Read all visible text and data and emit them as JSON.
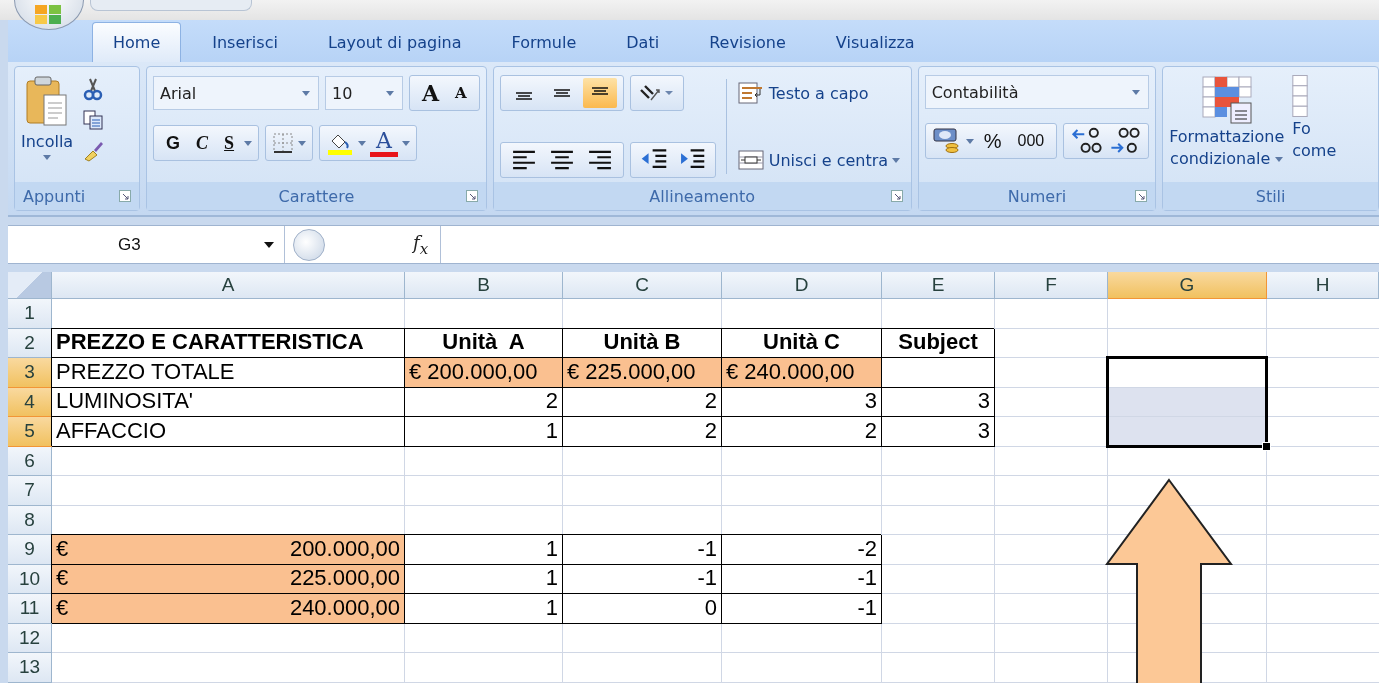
{
  "tabs": [
    {
      "label": "Home",
      "selected": true
    },
    {
      "label": "Inserisci",
      "selected": false
    },
    {
      "label": "Layout di pagina",
      "selected": false
    },
    {
      "label": "Formule",
      "selected": false
    },
    {
      "label": "Dati",
      "selected": false
    },
    {
      "label": "Revisione",
      "selected": false
    },
    {
      "label": "Visualizza",
      "selected": false
    }
  ],
  "clipboard": {
    "paste_label": "Incolla",
    "group_label": "Appunti"
  },
  "font": {
    "family": "Arial",
    "size": "10",
    "grow": "A",
    "shrink": "A",
    "bold": "G",
    "italic": "C",
    "underline": "S",
    "color_letter": "A",
    "group_label": "Carattere"
  },
  "alignment": {
    "vertical": [
      {
        "kind": "top",
        "selected": false
      },
      {
        "kind": "middle",
        "selected": false
      },
      {
        "kind": "bottom",
        "selected": true
      }
    ],
    "wrap": "Testo a capo",
    "merge": "Unisci e centra",
    "group_label": "Allineamento"
  },
  "number": {
    "format": "Contabilità",
    "percent": "%",
    "thousands": "000",
    "group_label": "Numeri"
  },
  "styles": {
    "conditional": [
      "Formattazione",
      "condizionale"
    ],
    "table": [
      "Fo",
      "come"
    ],
    "group_label": "Stili"
  },
  "formula_bar": {
    "name_box": "G3",
    "fx": "f$_{x}$"
  },
  "sheet": {
    "columns": [
      {
        "label": "A",
        "selected": false
      },
      {
        "label": "B",
        "selected": false
      },
      {
        "label": "C",
        "selected": false
      },
      {
        "label": "D",
        "selected": false
      },
      {
        "label": "E",
        "selected": false
      },
      {
        "label": "F",
        "selected": false
      },
      {
        "label": "G",
        "selected": true
      },
      {
        "label": "H",
        "selected": false
      }
    ],
    "rows": [
      {
        "number": "1",
        "selected": false
      },
      {
        "number": "2",
        "selected": false,
        "cells": [
          {
            "kind": "bold",
            "text": "PREZZO E CARATTERISTICA",
            "highlighted": false,
            "bordered": true
          },
          {
            "kind": "heading",
            "text": "Unità  A",
            "highlighted": false,
            "bordered": true
          },
          {
            "kind": "heading",
            "text": "Unità B",
            "highlighted": false,
            "bordered": true
          },
          {
            "kind": "heading",
            "text": "Unità C",
            "highlighted": false,
            "bordered": true
          },
          {
            "kind": "heading",
            "text": "Subject",
            "highlighted": false,
            "bordered": true
          }
        ]
      },
      {
        "number": "3",
        "selected": true,
        "cells": [
          {
            "kind": "text",
            "text": "PREZZO TOTALE",
            "highlighted": false,
            "bordered": true
          },
          {
            "kind": "text",
            "text": "€ 200.000,00",
            "highlighted": true,
            "bordered": true
          },
          {
            "kind": "text",
            "text": "€ 225.000,00",
            "highlighted": true,
            "bordered": true
          },
          {
            "kind": "text",
            "text": "€ 240.000,00",
            "highlighted": true,
            "bordered": true
          },
          {
            "kind": "empty",
            "highlighted": false,
            "bordered": true
          }
        ]
      },
      {
        "number": "4",
        "selected": true,
        "cells": [
          {
            "kind": "text",
            "text": "LUMINOSITA'",
            "highlighted": false,
            "bordered": true
          },
          {
            "kind": "number",
            "text": "2",
            "highlighted": false,
            "bordered": true
          },
          {
            "kind": "number",
            "text": "2",
            "highlighted": false,
            "bordered": true
          },
          {
            "kind": "number",
            "text": "3",
            "highlighted": false,
            "bordered": true
          },
          {
            "kind": "number",
            "text": "3",
            "highlighted": false,
            "bordered": true
          }
        ]
      },
      {
        "number": "5",
        "selected": true,
        "cells": [
          {
            "kind": "text",
            "text": "AFFACCIO",
            "highlighted": false,
            "bordered": true
          },
          {
            "kind": "number",
            "text": "1",
            "highlighted": false,
            "bordered": true
          },
          {
            "kind": "number",
            "text": "2",
            "highlighted": false,
            "bordered": true
          },
          {
            "kind": "number",
            "text": "2",
            "highlighted": false,
            "bordered": true
          },
          {
            "kind": "number",
            "text": "3",
            "highlighted": false,
            "bordered": true
          }
        ]
      },
      {
        "number": "6",
        "selected": false
      },
      {
        "number": "7",
        "selected": false
      },
      {
        "number": "8",
        "selected": false
      },
      {
        "number": "9",
        "selected": false,
        "cells": [
          {
            "kind": "currency",
            "symbol": "€",
            "text": "200.000,00",
            "highlighted": true,
            "bordered": true
          },
          {
            "kind": "number",
            "text": "1",
            "highlighted": false,
            "bordered": true
          },
          {
            "kind": "number",
            "text": "-1",
            "highlighted": false,
            "bordered": true
          },
          {
            "kind": "number",
            "text": "-2",
            "highlighted": false,
            "bordered": true
          }
        ]
      },
      {
        "number": "10",
        "selected": false,
        "cells": [
          {
            "kind": "currency",
            "symbol": "€",
            "text": "225.000,00",
            "highlighted": true,
            "bordered": true
          },
          {
            "kind": "number",
            "text": "1",
            "highlighted": false,
            "bordered": true
          },
          {
            "kind": "number",
            "text": "-1",
            "highlighted": false,
            "bordered": true
          },
          {
            "kind": "number",
            "text": "-1",
            "highlighted": false,
            "bordered": true
          }
        ]
      },
      {
        "number": "11",
        "selected": false,
        "cells": [
          {
            "kind": "currency",
            "symbol": "€",
            "text": "240.000,00",
            "highlighted": true,
            "bordered": true
          },
          {
            "kind": "number",
            "text": "1",
            "highlighted": false,
            "bordered": true
          },
          {
            "kind": "number",
            "text": "0",
            "highlighted": false,
            "bordered": true
          },
          {
            "kind": "number",
            "text": "-1",
            "highlighted": false,
            "bordered": true
          }
        ]
      },
      {
        "number": "12",
        "selected": false
      },
      {
        "number": "13",
        "selected": false
      }
    ]
  }
}
